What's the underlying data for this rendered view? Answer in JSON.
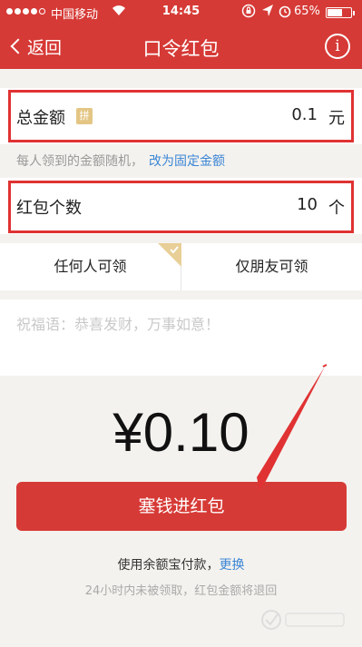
{
  "status_bar": {
    "carrier": "中国移动",
    "wifi_icon": "wifi-icon",
    "time": "14:45",
    "battery_percent": "65%",
    "battery_level": 0.65
  },
  "nav": {
    "back_label": "返回",
    "title": "口令红包",
    "info_label": "i"
  },
  "amount_row": {
    "label": "总金额",
    "badge": "拼",
    "value": "0.1",
    "unit": "元"
  },
  "hint": {
    "text": "每人领到的金额随机，",
    "link": "改为固定金额"
  },
  "count_row": {
    "label": "红包个数",
    "value": "10",
    "unit": "个"
  },
  "tabs": {
    "anyone": "任何人可领",
    "friends": "仅朋友可领",
    "selected": "anyone"
  },
  "blessing": {
    "placeholder": "祝福语：恭喜发财，万事如意！"
  },
  "total": {
    "amount": "¥0.10"
  },
  "pay_button": {
    "label": "塞钱进红包"
  },
  "payment": {
    "text": "使用余额宝付款，",
    "change_link": "更换"
  },
  "refund_note": "24小时内未被领取，红包金额将退回",
  "colors": {
    "accent": "#d63a36",
    "link": "#3b86d6",
    "highlight_border": "#e03233",
    "badge_gold": "#e4c684"
  }
}
